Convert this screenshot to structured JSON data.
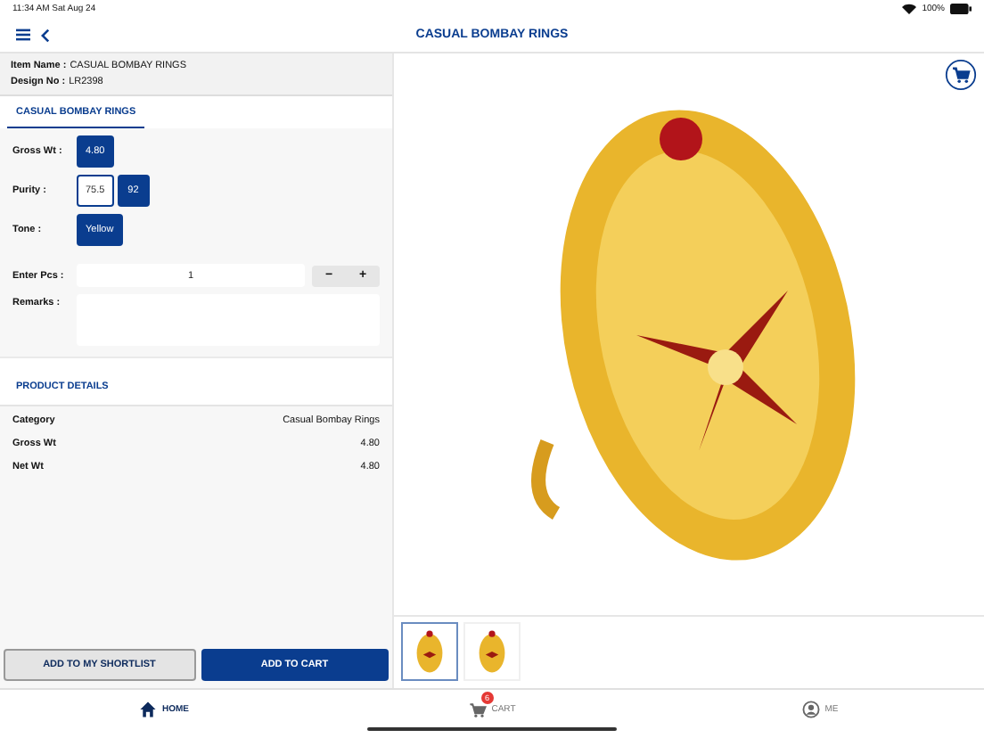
{
  "status_bar": {
    "time": "11:34 AM",
    "date": "Sat Aug 24",
    "battery": "100%"
  },
  "nav": {
    "title": "CASUAL BOMBAY RINGS"
  },
  "item_info": [
    {
      "label": "Item Name :",
      "value": "CASUAL BOMBAY RINGS"
    },
    {
      "label": "Design No :",
      "value": "LR2398"
    }
  ],
  "tabs": [
    {
      "label": "CASUAL BOMBAY RINGS",
      "selected": true
    }
  ],
  "options": [
    {
      "label": "Gross Wt :",
      "choices": [
        {
          "label": "4.80",
          "selected": true
        }
      ]
    },
    {
      "label": "Purity :",
      "choices": [
        {
          "label": "75.5",
          "selected": false
        },
        {
          "label": "92",
          "selected": true
        }
      ]
    },
    {
      "label": "Tone :",
      "choices": [
        {
          "label": "Yellow",
          "selected": true
        }
      ]
    }
  ],
  "pieces": {
    "label": "Enter Pcs :",
    "value": "1",
    "minus": "−",
    "plus": "+"
  },
  "remarks": {
    "label": "Remarks :"
  },
  "product_details": {
    "title": "PRODUCT DETAILS",
    "rows": [
      {
        "name": "Category",
        "value": "Casual Bombay Rings"
      },
      {
        "name": "Gross Wt",
        "value": "4.80"
      },
      {
        "name": "Net Wt",
        "value": "4.80"
      }
    ]
  },
  "buttons": [
    {
      "kind": "secondary",
      "label": "ADD TO MY SHORTLIST"
    },
    {
      "kind": "primary",
      "label": "ADD TO CART"
    }
  ],
  "thumbnails": [
    {
      "selected": true
    },
    {
      "selected": false
    }
  ],
  "bottom_tabs": [
    {
      "kind": "home",
      "label": "HOME",
      "selected": true
    },
    {
      "kind": "cart",
      "label": "CART",
      "selected": false,
      "badge": "6"
    },
    {
      "kind": "me",
      "label": "ME",
      "selected": false
    }
  ]
}
